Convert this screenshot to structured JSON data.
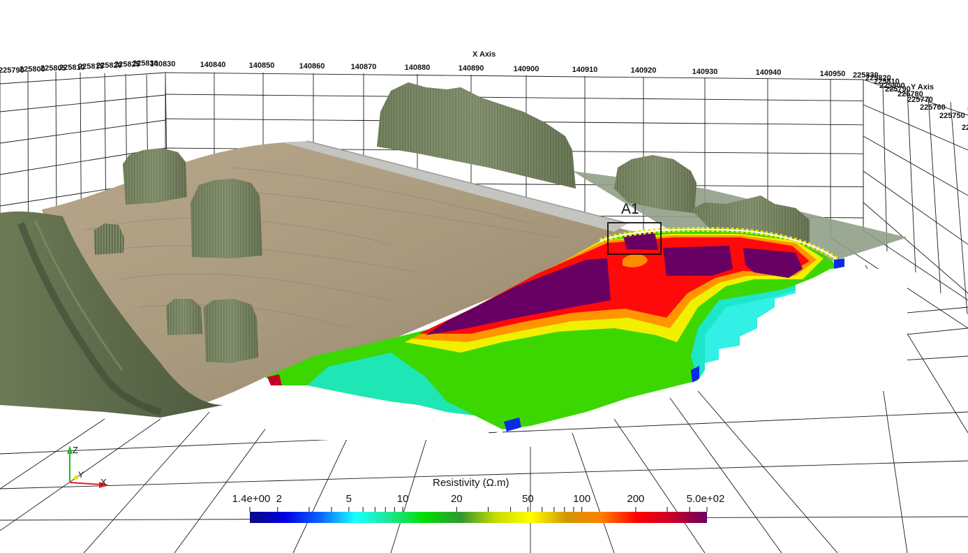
{
  "x_axis": {
    "title": "X Axis",
    "ticks": [
      "140830",
      "140840",
      "140850",
      "140860",
      "140870",
      "140880",
      "140890",
      "140900",
      "140910",
      "140920",
      "140930",
      "140940",
      "140950"
    ]
  },
  "y_axis": {
    "title": "Y Axis",
    "ticks_left": [
      "225790",
      "225800",
      "225805",
      "225810",
      "225815",
      "225820",
      "225825",
      "225830"
    ],
    "ticks_right": [
      "225830",
      "225820",
      "225810",
      "225800",
      "225790",
      "225780",
      "225770",
      "225760",
      "225750",
      "22"
    ]
  },
  "marker": {
    "label": "A1"
  },
  "colorbar": {
    "title": "Resistivity (Ω.m)",
    "ticks": [
      "1.4e+00",
      "2",
      "5",
      "10",
      "20",
      "50",
      "100",
      "200",
      "5.0e+02"
    ],
    "range": [
      1.4,
      500
    ],
    "scale": "log",
    "colors": [
      "#0a0a82",
      "#0000e6",
      "#0a64ff",
      "#19ffff",
      "#1ee68c",
      "#00dc00",
      "#329632",
      "#c8dc00",
      "#ffff00",
      "#d29600",
      "#ff8000",
      "#ff0000",
      "#c80028",
      "#680063"
    ]
  },
  "orientation": {
    "z": "Z",
    "y": "Y",
    "x": "X"
  }
}
